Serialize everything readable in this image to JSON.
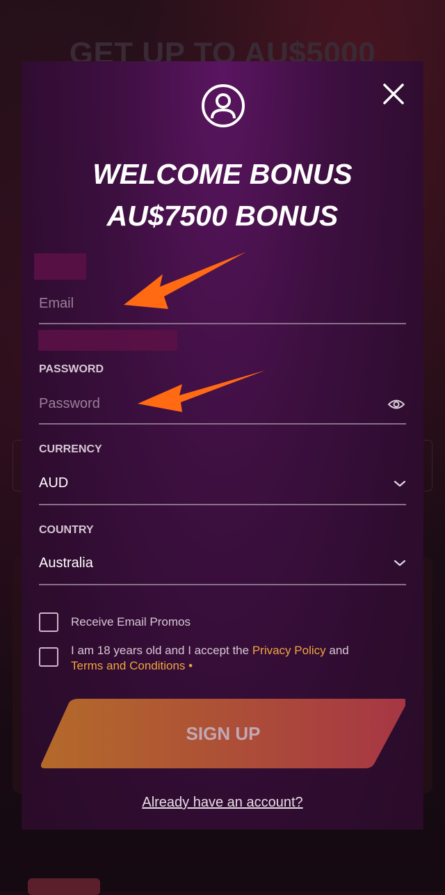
{
  "background": {
    "headline": "GET UP TO AU$5000"
  },
  "modal": {
    "title_line1": "WELCOME BONUS",
    "title_line2": "AU$7500 BONUS",
    "close_icon": "close-icon",
    "user_icon": "user-circle-icon"
  },
  "form": {
    "email": {
      "placeholder": "Email",
      "value": ""
    },
    "password": {
      "label": "PASSWORD",
      "placeholder": "Password",
      "value": ""
    },
    "currency": {
      "label": "CURRENCY",
      "selected": "AUD"
    },
    "country": {
      "label": "COUNTRY",
      "selected": "Australia"
    },
    "promos_label": "Receive Email Promos",
    "terms": {
      "prefix": "I am 18 years old and I accept the ",
      "privacy": "Privacy Policy",
      "middle": " and",
      "terms_link": "Terms and Conditions",
      "suffix": " •"
    },
    "submit_label": "SIGN UP",
    "login_link": "Already have an account?"
  },
  "colors": {
    "accent_orange": "#f0a43c",
    "arrow_orange": "#ff6a13",
    "button_start": "#b46a2a",
    "button_end": "#a63644"
  }
}
